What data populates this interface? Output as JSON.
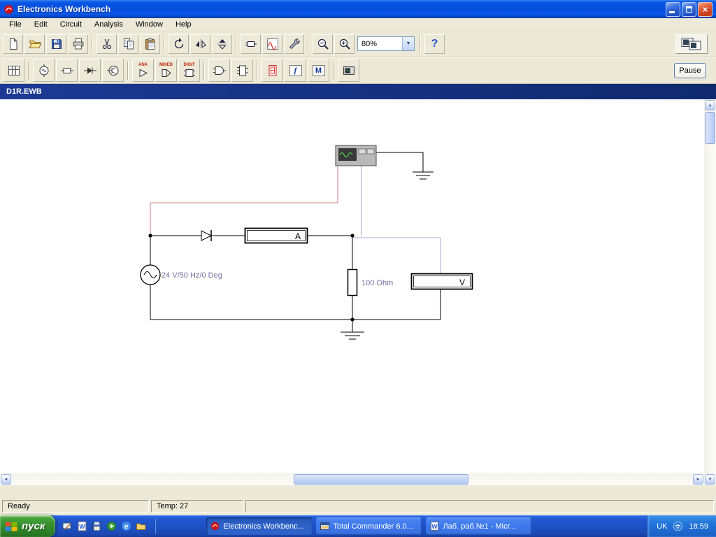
{
  "colors": {
    "titlebar_blue": "#0350de",
    "taskbar_blue": "#1e52c6",
    "start_green": "#389330",
    "doc_title_navy": "#10296e",
    "toolbar_face": "#ece9d8",
    "wire_black": "#000000",
    "probe_wire_red": "#c87f7f",
    "probe_wire_gray": "#9b9bbd",
    "voltmeter_wire_lavender": "#a8a8cc",
    "component_label_blue": "#7474a8",
    "bin_label_red": "#c42000"
  },
  "titlebar": {
    "title": "Electronics Workbench"
  },
  "menubar": {
    "items": [
      "File",
      "Edit",
      "Circuit",
      "Analysis",
      "Window",
      "Help"
    ]
  },
  "toolbar": {
    "zoom_value": "80%",
    "help_label": "?",
    "pause_label": "Pause",
    "bins": {
      "analog": "ANA",
      "mixed": "MIXED",
      "digital": "DIGIT",
      "controls": "f",
      "misc": "M"
    }
  },
  "document": {
    "title": "D1R.EWB"
  },
  "circuit": {
    "source_label": "24 V/50 Hz/0 Deg",
    "resistor_label": "100 Ohm",
    "ammeter_label": "A",
    "voltmeter_label": "V"
  },
  "statusbar": {
    "ready": "Ready",
    "temp": "Temp: 27"
  },
  "taskbar": {
    "start_label": "пуск",
    "tasks": [
      "Electronics Workbenc...",
      "Total Commander 6.0...",
      "Лаб. раб.№1 - Micr..."
    ],
    "language": "UK",
    "time": "18:59"
  },
  "icons": {
    "scroll_up": "▲",
    "scroll_down": "▼",
    "scroll_left": "◄",
    "scroll_right": "►",
    "dropdown_arrow": "▼",
    "close_glyph": "×",
    "word_glyph": "W",
    "ie_glyph": "e"
  }
}
